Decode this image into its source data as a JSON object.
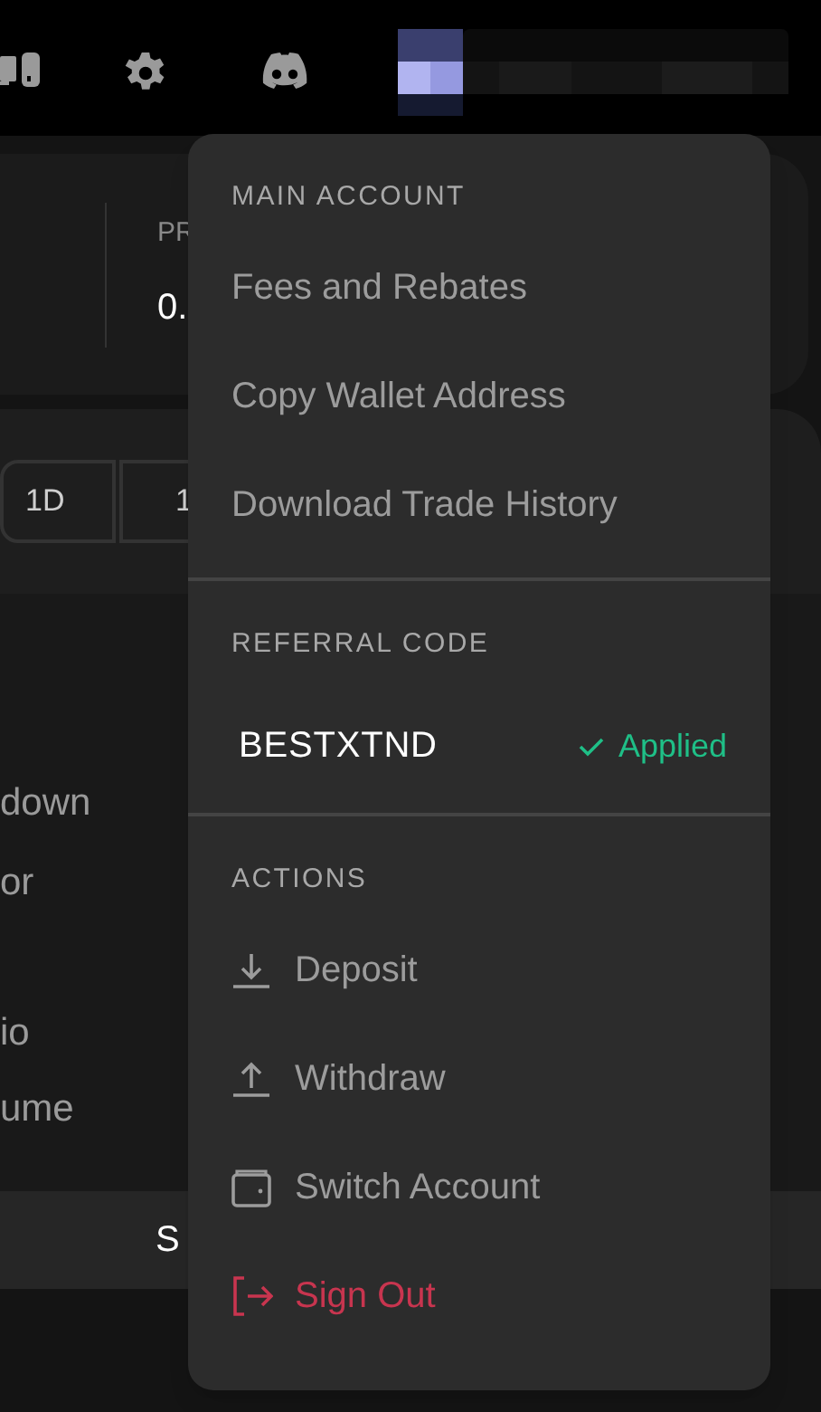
{
  "background": {
    "stat_label": "PR",
    "stat_value": "0.",
    "timeframes": [
      "1D",
      "1"
    ],
    "side_labels": [
      "down",
      "or",
      "io",
      "ume"
    ],
    "bar_label": "S"
  },
  "account_menu": {
    "main_account": {
      "heading": "MAIN ACCOUNT",
      "items": [
        {
          "label": "Fees and Rebates"
        },
        {
          "label": "Copy Wallet Address"
        },
        {
          "label": "Download Trade History"
        }
      ]
    },
    "referral": {
      "heading": "REFERRAL CODE",
      "code": "BESTXTND",
      "status": "Applied"
    },
    "actions": {
      "heading": "ACTIONS",
      "items": [
        {
          "label": "Deposit",
          "kind": "deposit"
        },
        {
          "label": "Withdraw",
          "kind": "withdraw"
        },
        {
          "label": "Switch Account",
          "kind": "switch"
        },
        {
          "label": "Sign Out",
          "kind": "signout"
        }
      ]
    }
  }
}
